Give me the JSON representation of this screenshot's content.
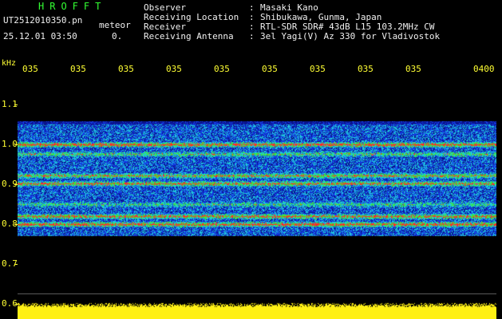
{
  "header": {
    "title": "HROFFT",
    "filename": "UT2512010350.pn",
    "kind": "meteor",
    "datetime": "25.12.01 03:50",
    "extra": "0."
  },
  "metadata": [
    {
      "label": "Observer",
      "value": "Masaki Kano"
    },
    {
      "label": "Receiving Location",
      "value": "Shibukawa, Gunma, Japan"
    },
    {
      "label": "Receiver",
      "value": "RTL-SDR SDR# 43dB L15 103.2MHz CW"
    },
    {
      "label": "Receiving Antenna",
      "value": "3el Yagi(V) Az 330 for Vladivostok"
    }
  ],
  "axis": {
    "y_unit": "kHz",
    "y_ticks": [
      "1.1",
      "1.0",
      "0.9",
      "0.8",
      "0.7",
      "0.6"
    ],
    "x_ticks": [
      "035",
      "035",
      "035",
      "035",
      "035",
      "035",
      "035",
      "035",
      "035",
      "0400"
    ]
  },
  "colors": {
    "text_green": "#33ff33",
    "text_yellow": "#ffff33",
    "text_white": "#f0f0f0",
    "background": "#000000"
  }
}
